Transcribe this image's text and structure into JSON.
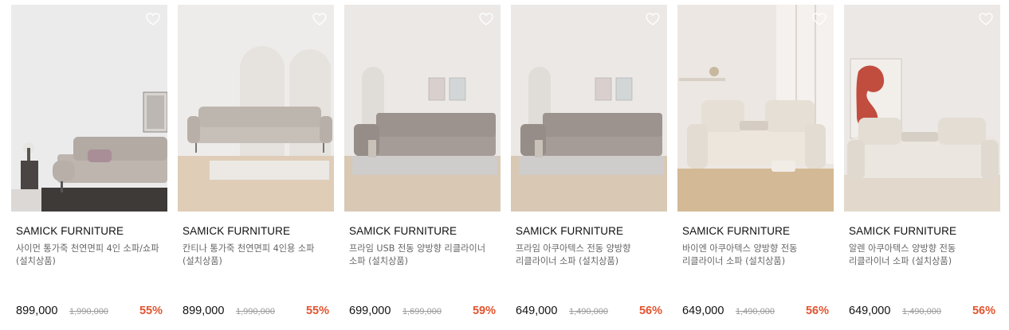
{
  "products": [
    {
      "brand": "SAMICK FURNITURE",
      "name": "사이먼 통가죽 천연면피 4인 소파/쇼파 (설치상품)",
      "price": "899,000",
      "original_price": "1,990,000",
      "discount": "55%",
      "sofa_color": "#bdb5ae"
    },
    {
      "brand": "SAMICK FURNITURE",
      "name": "칸티나 통가죽 천연면피 4인용 소파 (설치상품)",
      "price": "899,000",
      "original_price": "1,990,000",
      "discount": "55%",
      "sofa_color": "#c7c0b8"
    },
    {
      "brand": "SAMICK FURNITURE",
      "name": "프라임 USB 전동 양방향 리클라이너 소파 (설치상품)",
      "price": "699,000",
      "original_price": "1,699,000",
      "discount": "59%",
      "sofa_color": "#a59c98"
    },
    {
      "brand": "SAMICK FURNITURE",
      "name": "프라임 아쿠아텍스 전동 양방향 리클라이너 소파 (설치상품)",
      "price": "649,000",
      "original_price": "1,490,000",
      "discount": "56%",
      "sofa_color": "#a59c98"
    },
    {
      "brand": "SAMICK FURNITURE",
      "name": "바이엔 아쿠아텍스 양방향 전동 리클라이너 소파 (설치상품)",
      "price": "649,000",
      "original_price": "1,490,000",
      "discount": "56%",
      "sofa_color": "#ece6dd"
    },
    {
      "brand": "SAMICK FURNITURE",
      "name": "알렌 아쿠아텍스 양방향 전동 리클라이너 소파 (설치상품)",
      "price": "649,000",
      "original_price": "1,490,000",
      "discount": "56%",
      "sofa_color": "#ebe6df"
    }
  ],
  "icons": {
    "wishlist": "heart-outline-icon"
  },
  "colors": {
    "discount": "#e2542f",
    "original_price": "#9a9a9a",
    "product_name": "#666666"
  }
}
